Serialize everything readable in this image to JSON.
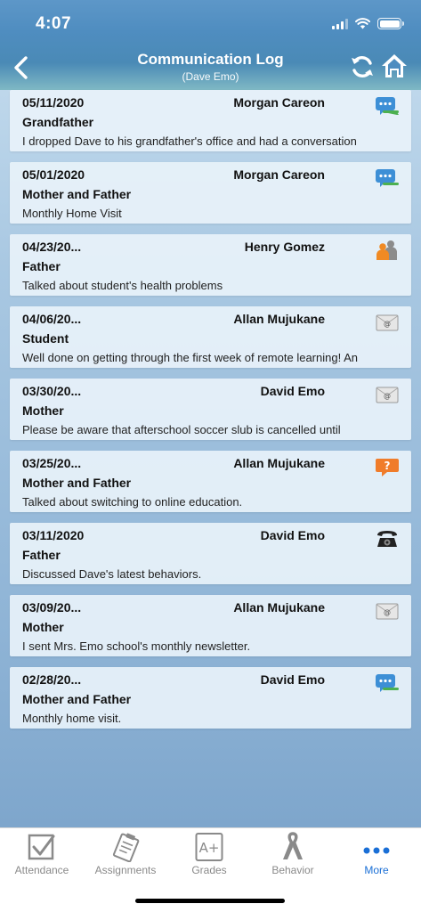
{
  "status": {
    "time": "4:07"
  },
  "header": {
    "title": "Communication Log",
    "subtitle": "(Dave Emo)"
  },
  "entries": [
    {
      "date": "05/11/2020",
      "name": "Morgan Careon",
      "relation": "Grandfather",
      "note": "I dropped Dave to his grandfather's office and had a conversation",
      "type": "chat-icon"
    },
    {
      "date": "05/01/2020",
      "name": "Morgan Careon",
      "relation": "Mother and Father",
      "note": "Monthly Home Visit",
      "type": "chat-icon"
    },
    {
      "date": "04/23/20...",
      "name": "Henry Gomez",
      "relation": "Father",
      "note": "Talked about student's health problems",
      "type": "meeting-icon"
    },
    {
      "date": "04/06/20...",
      "name": "Allan Mujukane",
      "relation": "Student",
      "note": "Well done on getting through the first week of remote learning! An",
      "type": "email-icon"
    },
    {
      "date": "03/30/20...",
      "name": "David Emo",
      "relation": "Mother",
      "note": "Please be aware that afterschool soccer slub is cancelled until",
      "type": "email-icon"
    },
    {
      "date": "03/25/20...",
      "name": "Allan Mujukane",
      "relation": "Mother and Father",
      "note": "Talked about switching to online education.",
      "type": "question-icon"
    },
    {
      "date": "03/11/2020",
      "name": "David Emo",
      "relation": "Father",
      "note": "Discussed Dave's latest behaviors.",
      "type": "phone-icon"
    },
    {
      "date": "03/09/20...",
      "name": "Allan Mujukane",
      "relation": "Mother",
      "note": "I sent Mrs. Emo school's monthly newsletter.",
      "type": "email-icon"
    },
    {
      "date": "02/28/20...",
      "name": "David Emo",
      "relation": "Mother and Father",
      "note": "Monthly home visit.",
      "type": "chat-icon"
    }
  ],
  "tabs": [
    {
      "label": "Attendance",
      "icon": "checkbox-icon"
    },
    {
      "label": "Assignments",
      "icon": "clipboard-icon"
    },
    {
      "label": "Grades",
      "icon": "grade-icon"
    },
    {
      "label": "Behavior",
      "icon": "ribbon-icon"
    },
    {
      "label": "More",
      "icon": "more-icon",
      "active": true
    }
  ],
  "colors": {
    "accent": "#1a6fd6",
    "header": "#4f8dc0",
    "chat": "#3d8fd6",
    "question": "#f07c2a"
  }
}
